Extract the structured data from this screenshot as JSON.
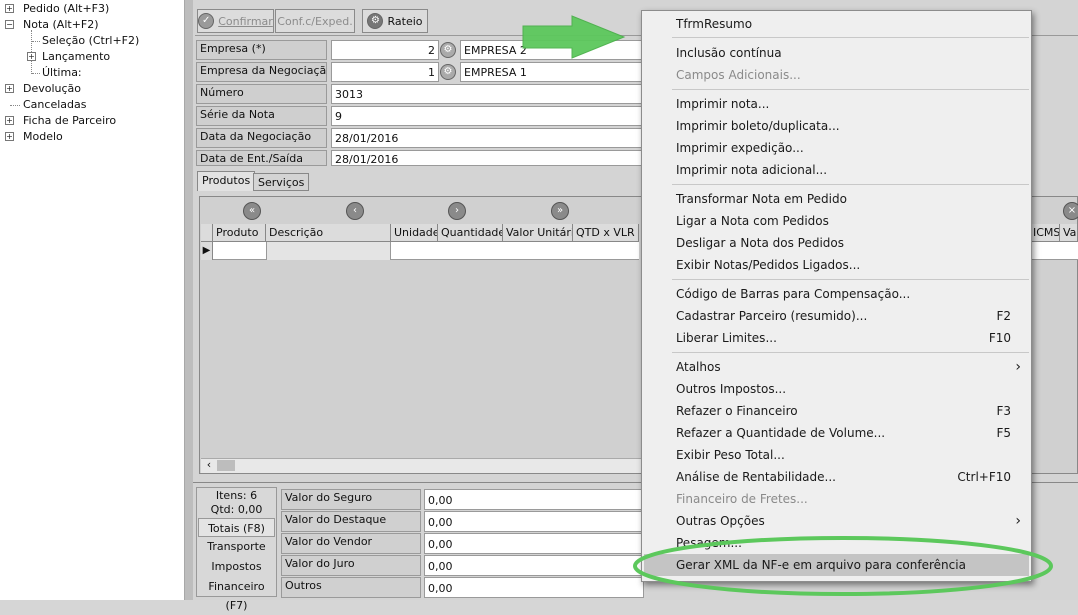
{
  "tree": {
    "items": [
      {
        "label": "Pedido  (Alt+F3)",
        "expander": "+"
      },
      {
        "label": "Nota  (Alt+F2)",
        "expander": "−"
      },
      {
        "label": "Seleção (Ctrl+F2)"
      },
      {
        "label": "Lançamento",
        "expander": "+"
      },
      {
        "label": "Última:"
      },
      {
        "label": "Devolução",
        "expander": "+"
      },
      {
        "label": "Canceladas"
      },
      {
        "label": "Ficha de Parceiro",
        "expander": "+"
      },
      {
        "label": "Modelo",
        "expander": "+"
      }
    ]
  },
  "toolbar": {
    "confirmar": "Confirmar",
    "conf_exped": "Conf.c/Exped.",
    "rateio": "Rateio"
  },
  "form": {
    "empresa_label": "Empresa (*)",
    "empresa_code": "2",
    "empresa_name": "EMPRESA 2",
    "empresa_neg_label": "Empresa da Negociação",
    "empresa_neg_code": "1",
    "empresa_neg_name": "EMPRESA 1",
    "numero_label": "Número",
    "numero_value": "3013",
    "serie_label": "Série da Nota",
    "serie_value": "9",
    "data_neg_label": "Data da Negociação",
    "data_neg_value": "28/01/2016",
    "data_ent_label": "Data de Ent./Saída",
    "data_ent_value": "28/01/2016"
  },
  "tabs": {
    "produtos": "Produtos",
    "servicos": "Serviços"
  },
  "grid": {
    "columns": [
      "Produto",
      "Descrição",
      "Unidade",
      "Quantidade",
      "Valor Unitário",
      "QTD x VLR"
    ],
    "right_columns": [
      "ICMS",
      "Val"
    ]
  },
  "bottom": {
    "itens": "Itens: 6",
    "qtd": "Qtd: 0,00",
    "buttons": [
      "Totais  (F8)",
      "Transporte",
      "Impostos",
      "Financeiro (F7)"
    ],
    "rows": [
      {
        "label": "Valor do Seguro",
        "value": "0,00"
      },
      {
        "label": "Valor do Destaque",
        "value": "0,00"
      },
      {
        "label": "Valor do Vendor",
        "value": "0,00"
      },
      {
        "label": "Valor do Juro",
        "value": "0,00"
      },
      {
        "label": "Outros",
        "value": "0,00"
      }
    ]
  },
  "menu": {
    "items": [
      {
        "label": "TfrmResumo"
      },
      {
        "label": "Inclusão contínua"
      },
      {
        "label": "Campos Adicionais...",
        "disabled": true
      },
      {
        "label": "Imprimir nota..."
      },
      {
        "label": "Imprimir boleto/duplicata..."
      },
      {
        "label": "Imprimir expedição..."
      },
      {
        "label": "Imprimir nota adicional..."
      },
      {
        "label": "Transformar Nota em Pedido"
      },
      {
        "label": "Ligar a Nota com Pedidos"
      },
      {
        "label": "Desligar a Nota dos Pedidos"
      },
      {
        "label": "Exibir Notas/Pedidos Ligados..."
      },
      {
        "label": "Código de Barras para Compensação..."
      },
      {
        "label": "Cadastrar Parceiro (resumido)...",
        "shortcut": "F2"
      },
      {
        "label": "Liberar Limites...",
        "shortcut": "F10"
      },
      {
        "label": "Atalhos",
        "submenu": "›"
      },
      {
        "label": "Outros Impostos..."
      },
      {
        "label": "Refazer o Financeiro",
        "shortcut": "F3"
      },
      {
        "label": "Refazer a Quantidade de Volume...",
        "shortcut": "F5"
      },
      {
        "label": "Exibir Peso Total..."
      },
      {
        "label": "Análise de Rentabilidade...",
        "shortcut": "Ctrl+F10"
      },
      {
        "label": "Financeiro de Fretes...",
        "disabled": true
      },
      {
        "label": "Outras Opções",
        "submenu": "›"
      },
      {
        "label": "Pesagem..."
      },
      {
        "label": "Gerar XML da NF-e em arquivo para conferência"
      }
    ]
  },
  "colors": {
    "arrow": "#5cc85c",
    "ellipse": "#5cc85c",
    "highlight": "#c4c4c4"
  }
}
